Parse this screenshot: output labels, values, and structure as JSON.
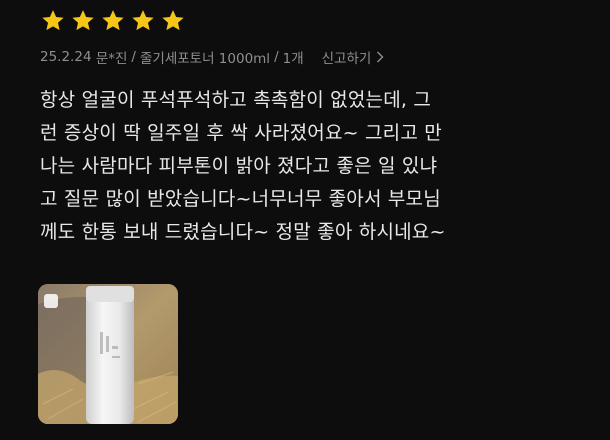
{
  "rating": {
    "stars": 5,
    "max": 5,
    "star_color": "#f5c518"
  },
  "meta": {
    "date": "25.2.24",
    "author": "문*진",
    "product": "줄기세포토너 1000ml",
    "quantity": "1개",
    "separator": "/",
    "report_label": "신고하기",
    "report_icon": "chevron-right-icon"
  },
  "review": {
    "lines": [
      "항상 얼굴이 푸석푸석하고 촉촉함이 없었는데, 그",
      "런 증상이 딱 일주일 후 싹 사라졌어요~ 그리고 만",
      "나는 사람마다 피부톤이 밝아 졌다고 좋은 일 있냐",
      "고 질문 많이 받았습니다~너무너무 좋아서 부모님",
      "께도 한통 보내 드렸습니다~ 정말 좋아 하시네요~"
    ]
  },
  "photo": {
    "icon": "review-photo-thumbnail"
  }
}
